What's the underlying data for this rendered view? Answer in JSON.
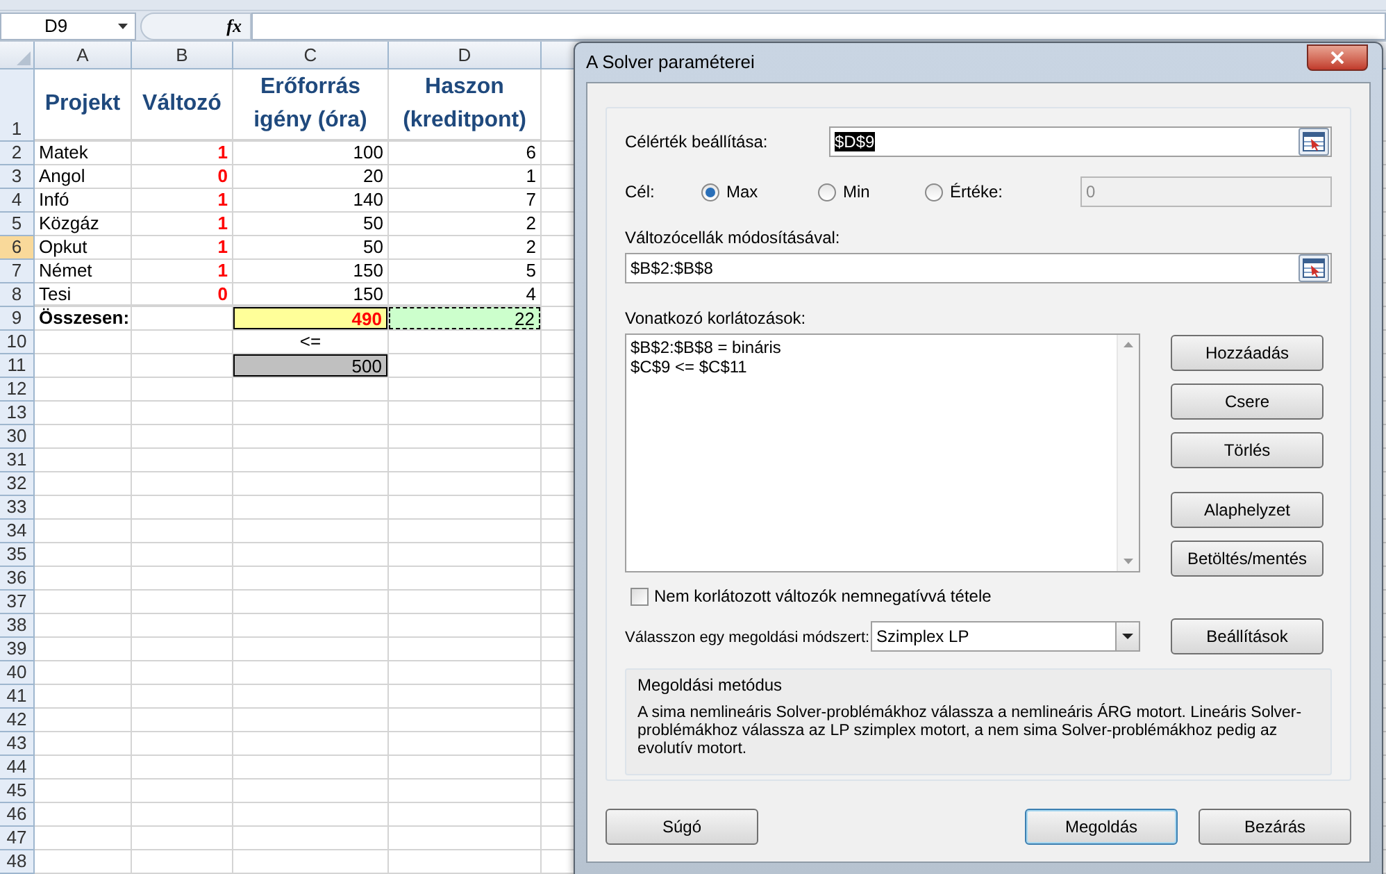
{
  "formula_bar": {
    "name_box": "D9",
    "function_label": "fx"
  },
  "columns": [
    {
      "label": "A"
    },
    {
      "label": "B"
    },
    {
      "label": "C"
    },
    {
      "label": "D"
    }
  ],
  "rows": [
    {
      "number": "1",
      "selected": false,
      "kind": "heading",
      "cells": {
        "A": {
          "text": "Projekt",
          "kind": "heading"
        },
        "B": {
          "text": "Változó",
          "kind": "heading"
        },
        "C": {
          "text": "Erőforrás igény (óra)",
          "kind": "heading"
        },
        "D": {
          "text": "Haszon (kreditpont)",
          "kind": "heading"
        }
      }
    },
    {
      "number": "2",
      "selected": false,
      "kind": "data",
      "cells": {
        "A": {
          "text": "Matek",
          "kind": "label"
        },
        "B": {
          "text": "1",
          "kind": "binary"
        },
        "C": {
          "text": "100",
          "kind": "number"
        },
        "D": {
          "text": "6",
          "kind": "number"
        }
      }
    },
    {
      "number": "3",
      "selected": false,
      "kind": "data",
      "cells": {
        "A": {
          "text": "Angol",
          "kind": "label"
        },
        "B": {
          "text": "0",
          "kind": "binary"
        },
        "C": {
          "text": "20",
          "kind": "number"
        },
        "D": {
          "text": "1",
          "kind": "number"
        }
      }
    },
    {
      "number": "4",
      "selected": false,
      "kind": "data",
      "cells": {
        "A": {
          "text": "Infó",
          "kind": "label"
        },
        "B": {
          "text": "1",
          "kind": "binary"
        },
        "C": {
          "text": "140",
          "kind": "number"
        },
        "D": {
          "text": "7",
          "kind": "number"
        }
      }
    },
    {
      "number": "5",
      "selected": false,
      "kind": "data",
      "cells": {
        "A": {
          "text": "Közgáz",
          "kind": "label"
        },
        "B": {
          "text": "1",
          "kind": "binary"
        },
        "C": {
          "text": "50",
          "kind": "number"
        },
        "D": {
          "text": "2",
          "kind": "number"
        }
      }
    },
    {
      "number": "6",
      "selected": true,
      "kind": "data",
      "cells": {
        "A": {
          "text": "Opkut",
          "kind": "label"
        },
        "B": {
          "text": "1",
          "kind": "binary"
        },
        "C": {
          "text": "50",
          "kind": "number"
        },
        "D": {
          "text": "2",
          "kind": "number"
        }
      }
    },
    {
      "number": "7",
      "selected": false,
      "kind": "data",
      "cells": {
        "A": {
          "text": "Német",
          "kind": "label"
        },
        "B": {
          "text": "1",
          "kind": "binary"
        },
        "C": {
          "text": "150",
          "kind": "number"
        },
        "D": {
          "text": "5",
          "kind": "number"
        }
      }
    },
    {
      "number": "8",
      "selected": false,
      "kind": "data_end",
      "cells": {
        "A": {
          "text": "Tesi",
          "kind": "label"
        },
        "B": {
          "text": "0",
          "kind": "binary"
        },
        "C": {
          "text": "150",
          "kind": "number"
        },
        "D": {
          "text": "4",
          "kind": "number"
        }
      }
    },
    {
      "number": "9",
      "selected": false,
      "kind": "data",
      "cells": {
        "A": {
          "text": "Összesen:",
          "kind": "total_label"
        },
        "C": {
          "text": "490",
          "kind": "sum"
        },
        "D": {
          "text": "22",
          "kind": "target"
        }
      }
    },
    {
      "number": "10",
      "selected": false,
      "kind": "data",
      "cells": {
        "C": {
          "text": "<=",
          "kind": "operator"
        }
      }
    },
    {
      "number": "11",
      "selected": false,
      "kind": "data",
      "cells": {
        "C": {
          "text": "500",
          "kind": "limit"
        }
      }
    },
    {
      "number": "12",
      "selected": false,
      "kind": "data"
    },
    {
      "number": "13",
      "selected": false,
      "kind": "data"
    },
    {
      "number": "30",
      "selected": false,
      "kind": "data"
    },
    {
      "number": "31",
      "selected": false,
      "kind": "data"
    },
    {
      "number": "32",
      "selected": false,
      "kind": "data"
    },
    {
      "number": "33",
      "selected": false,
      "kind": "data"
    },
    {
      "number": "34",
      "selected": false,
      "kind": "data"
    },
    {
      "number": "35",
      "selected": false,
      "kind": "data"
    },
    {
      "number": "36",
      "selected": false,
      "kind": "data"
    },
    {
      "number": "37",
      "selected": false,
      "kind": "data"
    },
    {
      "number": "38",
      "selected": false,
      "kind": "data"
    },
    {
      "number": "39",
      "selected": false,
      "kind": "data"
    },
    {
      "number": "40",
      "selected": false,
      "kind": "data"
    },
    {
      "number": "41",
      "selected": false,
      "kind": "data"
    },
    {
      "number": "42",
      "selected": false,
      "kind": "data"
    },
    {
      "number": "43",
      "selected": false,
      "kind": "data"
    },
    {
      "number": "44",
      "selected": false,
      "kind": "data"
    },
    {
      "number": "45",
      "selected": false,
      "kind": "data"
    },
    {
      "number": "46",
      "selected": false,
      "kind": "data"
    },
    {
      "number": "47",
      "selected": false,
      "kind": "data"
    },
    {
      "number": "48",
      "selected": false,
      "kind": "data"
    }
  ],
  "dialog": {
    "title": "A Solver paraméterei",
    "objective": {
      "label": "Célérték beállítása:",
      "value": "$D$9",
      "text_selected": true
    },
    "goal": {
      "label": "Cél:",
      "options": [
        {
          "label": "Max",
          "selected": true
        },
        {
          "label": "Min",
          "selected": false
        },
        {
          "label": "Értéke:",
          "selected": false
        }
      ],
      "value_field": {
        "value": "0",
        "disabled": true
      }
    },
    "variables": {
      "label": "Változócellák módosításával:",
      "value": "$B$2:$B$8"
    },
    "constraints": {
      "label": "Vonatkozó korlátozások:",
      "items": [
        "$B$2:$B$8 = bináris",
        "$C$9 <= $C$11"
      ]
    },
    "side_buttons": [
      {
        "label": "Hozzáadás"
      },
      {
        "label": "Csere"
      },
      {
        "label": "Törlés"
      },
      {
        "label": "Alaphelyzet"
      },
      {
        "label": "Betöltés/mentés"
      }
    ],
    "nonnegative": {
      "label": "Nem korlátozott változók nemnegatívvá tétele",
      "checked": false
    },
    "method": {
      "label": "Válasszon egy megoldási módszert:",
      "value": "Szimplex LP"
    },
    "options_button": "Beállítások",
    "method_info": {
      "title": "Megoldási metódus",
      "text": "A sima nemlineáris Solver-problémákhoz válassza a nemlineáris ÁRG motort. Lineáris Solver-problémákhoz válassza az LP szimplex motort, a nem sima Solver-problémákhoz pedig az evolutív motort."
    },
    "footer_buttons": [
      {
        "label": "Súgó",
        "default": false
      },
      {
        "label": "Megoldás",
        "default": true
      },
      {
        "label": "Bezárás",
        "default": false
      }
    ]
  }
}
